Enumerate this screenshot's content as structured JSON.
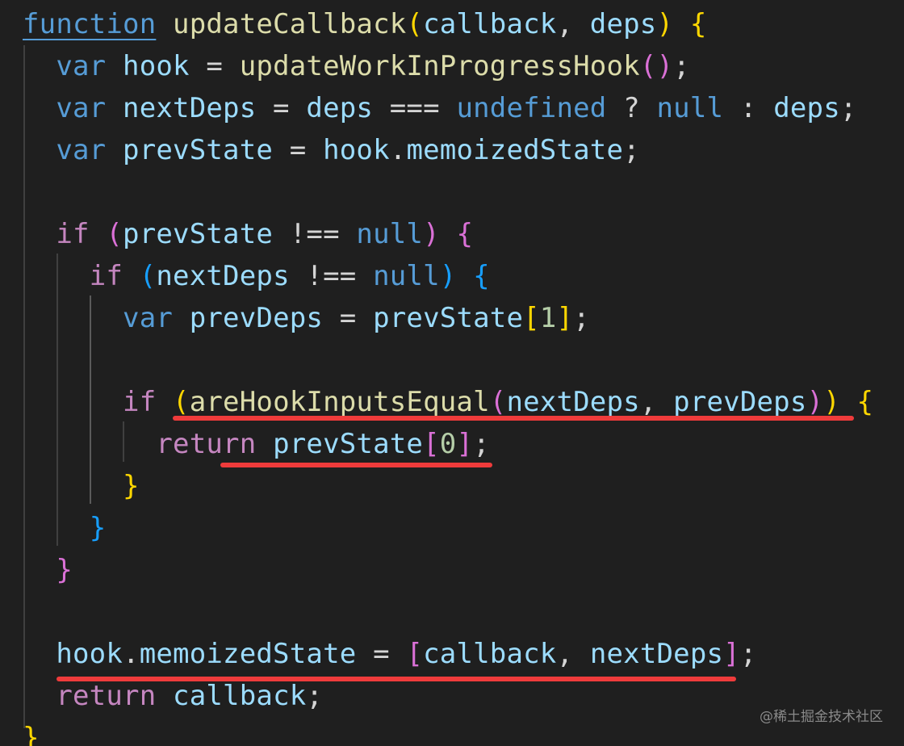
{
  "code_lines": [
    {
      "tokens": [
        {
          "t": "function",
          "c": "kw-fn"
        },
        {
          "t": " ",
          "c": "op"
        },
        {
          "t": "updateCallback",
          "c": "fn"
        },
        {
          "t": "(",
          "c": "b1"
        },
        {
          "t": "callback",
          "c": "var"
        },
        {
          "t": ", ",
          "c": "op"
        },
        {
          "t": "deps",
          "c": "var"
        },
        {
          "t": ")",
          "c": "b1"
        },
        {
          "t": " ",
          "c": "op"
        },
        {
          "t": "{",
          "c": "b1"
        }
      ]
    },
    {
      "tokens": [
        {
          "t": "  ",
          "c": "op"
        },
        {
          "t": "var",
          "c": "kw"
        },
        {
          "t": " ",
          "c": "op"
        },
        {
          "t": "hook",
          "c": "var"
        },
        {
          "t": " = ",
          "c": "op"
        },
        {
          "t": "updateWorkInProgressHook",
          "c": "fn"
        },
        {
          "t": "(",
          "c": "b2"
        },
        {
          "t": ")",
          "c": "b2"
        },
        {
          "t": ";",
          "c": "op"
        }
      ]
    },
    {
      "tokens": [
        {
          "t": "  ",
          "c": "op"
        },
        {
          "t": "var",
          "c": "kw"
        },
        {
          "t": " ",
          "c": "op"
        },
        {
          "t": "nextDeps",
          "c": "var"
        },
        {
          "t": " = ",
          "c": "op"
        },
        {
          "t": "deps",
          "c": "var"
        },
        {
          "t": " === ",
          "c": "op"
        },
        {
          "t": "undefined",
          "c": "kw"
        },
        {
          "t": " ? ",
          "c": "op"
        },
        {
          "t": "null",
          "c": "kw"
        },
        {
          "t": " : ",
          "c": "op"
        },
        {
          "t": "deps",
          "c": "var"
        },
        {
          "t": ";",
          "c": "op"
        }
      ]
    },
    {
      "tokens": [
        {
          "t": "  ",
          "c": "op"
        },
        {
          "t": "var",
          "c": "kw"
        },
        {
          "t": " ",
          "c": "op"
        },
        {
          "t": "prevState",
          "c": "var"
        },
        {
          "t": " = ",
          "c": "op"
        },
        {
          "t": "hook",
          "c": "var"
        },
        {
          "t": ".",
          "c": "op"
        },
        {
          "t": "memoizedState",
          "c": "var"
        },
        {
          "t": ";",
          "c": "op"
        }
      ]
    },
    {
      "tokens": []
    },
    {
      "tokens": [
        {
          "t": "  ",
          "c": "op"
        },
        {
          "t": "if",
          "c": "ctrl"
        },
        {
          "t": " ",
          "c": "op"
        },
        {
          "t": "(",
          "c": "b2"
        },
        {
          "t": "prevState",
          "c": "var"
        },
        {
          "t": " !== ",
          "c": "op"
        },
        {
          "t": "null",
          "c": "kw"
        },
        {
          "t": ")",
          "c": "b2"
        },
        {
          "t": " ",
          "c": "op"
        },
        {
          "t": "{",
          "c": "b2"
        }
      ]
    },
    {
      "tokens": [
        {
          "t": "    ",
          "c": "op"
        },
        {
          "t": "if",
          "c": "ctrl"
        },
        {
          "t": " ",
          "c": "op"
        },
        {
          "t": "(",
          "c": "b3"
        },
        {
          "t": "nextDeps",
          "c": "var"
        },
        {
          "t": " !== ",
          "c": "op"
        },
        {
          "t": "null",
          "c": "kw"
        },
        {
          "t": ")",
          "c": "b3"
        },
        {
          "t": " ",
          "c": "op"
        },
        {
          "t": "{",
          "c": "b3"
        }
      ]
    },
    {
      "tokens": [
        {
          "t": "      ",
          "c": "op"
        },
        {
          "t": "var",
          "c": "kw"
        },
        {
          "t": " ",
          "c": "op"
        },
        {
          "t": "prevDeps",
          "c": "var"
        },
        {
          "t": " = ",
          "c": "op"
        },
        {
          "t": "prevState",
          "c": "var"
        },
        {
          "t": "[",
          "c": "b1"
        },
        {
          "t": "1",
          "c": "num"
        },
        {
          "t": "]",
          "c": "b1"
        },
        {
          "t": ";",
          "c": "op"
        }
      ]
    },
    {
      "tokens": []
    },
    {
      "tokens": [
        {
          "t": "      ",
          "c": "op"
        },
        {
          "t": "if",
          "c": "ctrl"
        },
        {
          "t": " ",
          "c": "op"
        },
        {
          "t": "(",
          "c": "b1"
        },
        {
          "t": "areHookInputsEqual",
          "c": "fn"
        },
        {
          "t": "(",
          "c": "b2"
        },
        {
          "t": "nextDeps",
          "c": "var"
        },
        {
          "t": ", ",
          "c": "op"
        },
        {
          "t": "prevDeps",
          "c": "var"
        },
        {
          "t": ")",
          "c": "b2"
        },
        {
          "t": ")",
          "c": "b1"
        },
        {
          "t": " ",
          "c": "op"
        },
        {
          "t": "{",
          "c": "b1"
        }
      ]
    },
    {
      "tokens": [
        {
          "t": "        ",
          "c": "op"
        },
        {
          "t": "return",
          "c": "ctrl"
        },
        {
          "t": " ",
          "c": "op"
        },
        {
          "t": "prevState",
          "c": "var"
        },
        {
          "t": "[",
          "c": "b2"
        },
        {
          "t": "0",
          "c": "num"
        },
        {
          "t": "]",
          "c": "b2"
        },
        {
          "t": ";",
          "c": "op"
        }
      ]
    },
    {
      "tokens": [
        {
          "t": "      ",
          "c": "op"
        },
        {
          "t": "}",
          "c": "b1"
        }
      ]
    },
    {
      "tokens": [
        {
          "t": "    ",
          "c": "op"
        },
        {
          "t": "}",
          "c": "b3"
        }
      ]
    },
    {
      "tokens": [
        {
          "t": "  ",
          "c": "op"
        },
        {
          "t": "}",
          "c": "b2"
        }
      ]
    },
    {
      "tokens": []
    },
    {
      "tokens": [
        {
          "t": "  ",
          "c": "op"
        },
        {
          "t": "hook",
          "c": "var"
        },
        {
          "t": ".",
          "c": "op"
        },
        {
          "t": "memoizedState",
          "c": "var"
        },
        {
          "t": " = ",
          "c": "op"
        },
        {
          "t": "[",
          "c": "b2"
        },
        {
          "t": "callback",
          "c": "var"
        },
        {
          "t": ", ",
          "c": "op"
        },
        {
          "t": "nextDeps",
          "c": "var"
        },
        {
          "t": "]",
          "c": "b2"
        },
        {
          "t": ";",
          "c": "op"
        }
      ]
    },
    {
      "tokens": [
        {
          "t": "  ",
          "c": "op"
        },
        {
          "t": "return",
          "c": "ctrl"
        },
        {
          "t": " ",
          "c": "op"
        },
        {
          "t": "callback",
          "c": "var"
        },
        {
          "t": ";",
          "c": "op"
        }
      ]
    },
    {
      "tokens": [
        {
          "t": "}",
          "c": "b1"
        }
      ]
    }
  ],
  "watermark": "@稀土掘金技术社区"
}
